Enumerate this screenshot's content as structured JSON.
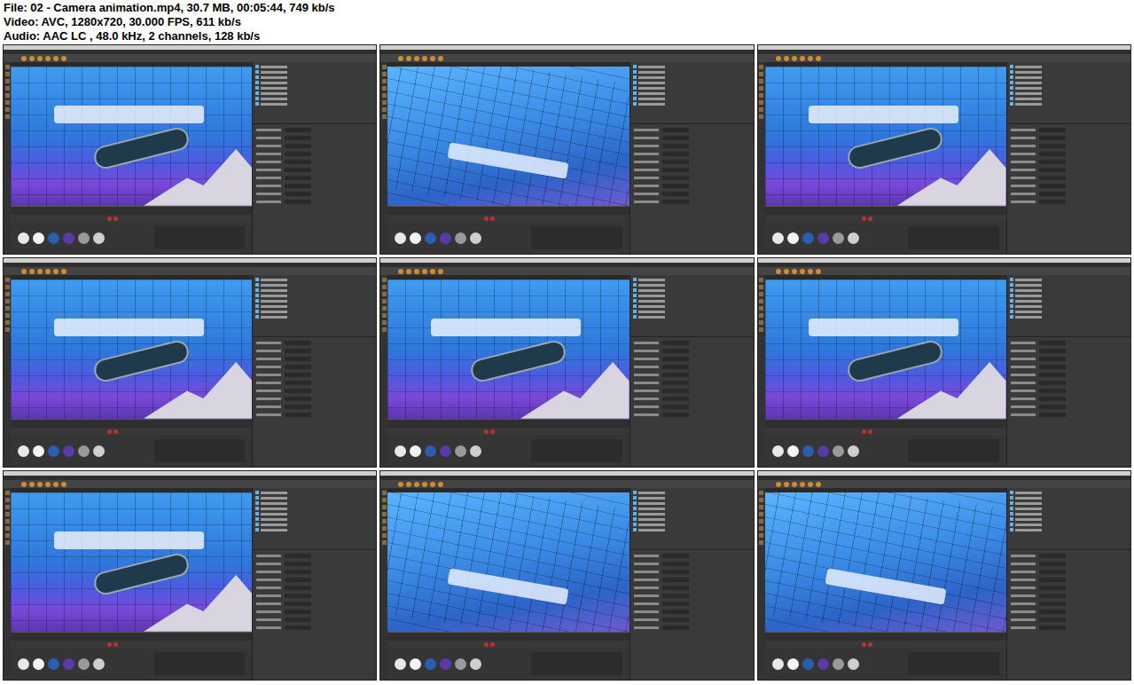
{
  "header": {
    "lines": [
      "File: 02 - Camera animation.mp4, 30.7 MB, 00:05:44, 749 kb/s",
      "Video: AVC, 1280x720, 30.000 FPS, 611 kb/s",
      "Audio: AAC LC , 48.0 kHz, 2 channels, 128 kb/s"
    ]
  },
  "thumbnails": [
    {
      "kind": "front"
    },
    {
      "kind": "angled"
    },
    {
      "kind": "front"
    },
    {
      "kind": "front"
    },
    {
      "kind": "front"
    },
    {
      "kind": "front"
    },
    {
      "kind": "front"
    },
    {
      "kind": "angled"
    },
    {
      "kind": "angled"
    }
  ]
}
